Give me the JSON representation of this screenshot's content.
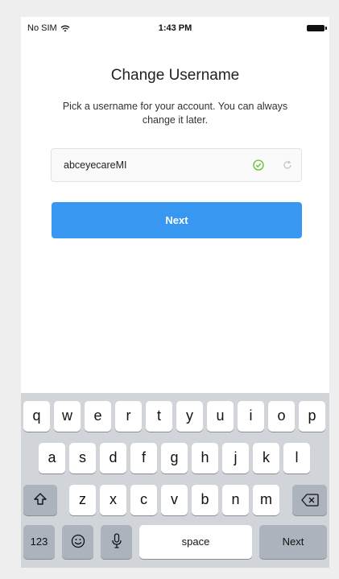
{
  "status_bar": {
    "carrier": "No SIM",
    "time": "1:43 PM"
  },
  "title": "Change Username",
  "subtitle": "Pick a username for your account. You can always change it later.",
  "username_field": {
    "value": "abceyecareMI",
    "valid_icon": "check-circle-icon",
    "refresh_icon": "refresh-icon"
  },
  "next_button": "Next",
  "keyboard": {
    "row1": [
      "q",
      "w",
      "e",
      "r",
      "t",
      "y",
      "u",
      "i",
      "o",
      "p"
    ],
    "row2": [
      "a",
      "s",
      "d",
      "f",
      "g",
      "h",
      "j",
      "k",
      "l"
    ],
    "row3": [
      "z",
      "x",
      "c",
      "v",
      "b",
      "n",
      "m"
    ],
    "numbers_key": "123",
    "space_key": "space",
    "return_key": "Next",
    "icons": {
      "shift": "shift-icon",
      "delete": "backspace-icon",
      "emoji": "emoji-icon",
      "mic": "microphone-icon"
    }
  }
}
